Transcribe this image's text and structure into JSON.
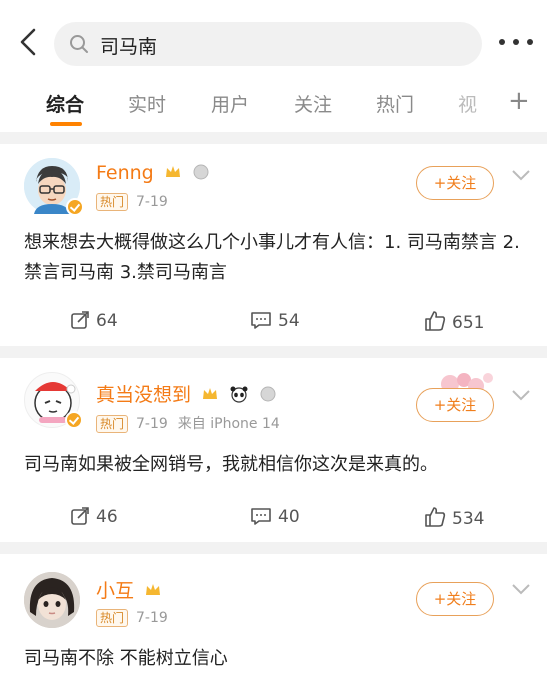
{
  "search": {
    "query": "司马南"
  },
  "tabs": [
    "综合",
    "实时",
    "用户",
    "关注",
    "热门",
    "视"
  ],
  "posts": [
    {
      "username": "Fenng",
      "hot_label": "热门",
      "date": "7-19",
      "source": "",
      "follow_label": "+关注",
      "text": "想来想去大概得做这么几个小事儿才有人信：1. 司马南禁言 2. 禁言司马南 3.禁司马南言",
      "reposts": "64",
      "comments": "54",
      "likes": "651"
    },
    {
      "username": "真当没想到",
      "hot_label": "热门",
      "date": "7-19",
      "source": "来自 iPhone 14",
      "follow_label": "+关注",
      "text": "司马南如果被全网销号，我就相信你这次是来真的。",
      "reposts": "46",
      "comments": "40",
      "likes": "534"
    },
    {
      "username": "小互",
      "hot_label": "热门",
      "date": "7-19",
      "source": "",
      "follow_label": "+关注",
      "text": "司马南不除 不能树立信心",
      "reposts": "",
      "comments": "",
      "likes": ""
    }
  ]
}
